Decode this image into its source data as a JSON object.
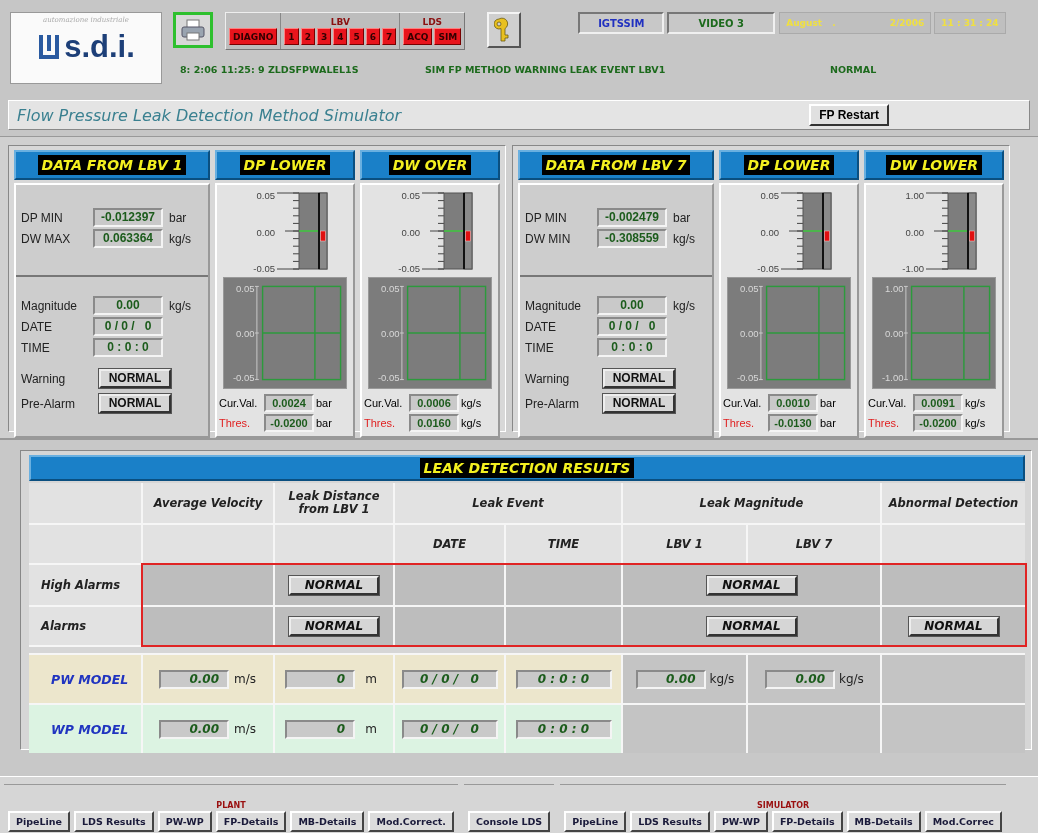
{
  "header": {
    "logo": {
      "tagline": "automazione industriale",
      "name": "s.d.i."
    },
    "diag_button": "DIAGNO",
    "lbv": {
      "label": "LBV",
      "buttons": [
        "1",
        "2",
        "3",
        "4",
        "5",
        "6",
        "7"
      ]
    },
    "lds": {
      "label": "LDS",
      "buttons": [
        "ACQ",
        "SIM"
      ]
    },
    "station": "IGTSSIM",
    "video": "VIDEO 3",
    "month": "August",
    "date_sep": ".",
    "date": "2/2006",
    "time": "11 : 31 : 24",
    "messages": [
      "8: 2:06 11:25: 9 ZLDSFPWALEL1S",
      "SIM FP METHOD WARNING LEAK EVENT LBV1",
      "NORMAL"
    ]
  },
  "title_bar": {
    "title": "Flow Pressure Leak Detection Method Simulator",
    "restart_button": "FP Restart"
  },
  "groups": [
    {
      "data_panel": {
        "title": "DATA FROM LBV 1",
        "readings": [
          {
            "label": "DP MIN",
            "value": "-0.012397",
            "unit": "bar"
          },
          {
            "label": "DW MAX",
            "value": "0.063364",
            "unit": "kg/s"
          }
        ],
        "event": [
          {
            "label": "Magnitude",
            "value": "0.00",
            "unit": "kg/s"
          },
          {
            "label": "DATE",
            "value": "0 / 0 /   0"
          },
          {
            "label": "TIME",
            "value": "0 : 0 : 0"
          }
        ],
        "status": [
          {
            "label": "Warning",
            "value": "NORMAL"
          },
          {
            "label": "Pre-Alarm",
            "value": "NORMAL"
          }
        ]
      },
      "gauges": [
        {
          "title": "DP LOWER",
          "scale": [
            "0.05",
            "0.00",
            "-0.05"
          ],
          "trend_scale": [
            "0.05",
            "0.00",
            "-0.05"
          ],
          "current": {
            "label": "Cur.Val.",
            "value": "0.0024",
            "unit": "bar"
          },
          "threshold": {
            "label": "Thres.",
            "value": "-0.0200",
            "unit": "bar"
          }
        },
        {
          "title": "DW OVER",
          "scale": [
            "0.05",
            "0.00",
            "-0.05"
          ],
          "trend_scale": [
            "0.05",
            "0.00",
            "-0.05"
          ],
          "current": {
            "label": "Cur.Val.",
            "value": "0.0006",
            "unit": "kg/s"
          },
          "threshold": {
            "label": "Thres.",
            "value": "0.0160",
            "unit": "kg/s"
          }
        }
      ]
    },
    {
      "data_panel": {
        "title": "DATA FROM LBV 7",
        "readings": [
          {
            "label": "DP MIN",
            "value": "-0.002479",
            "unit": "bar"
          },
          {
            "label": "DW MIN",
            "value": "-0.308559",
            "unit": "kg/s"
          }
        ],
        "event": [
          {
            "label": "Magnitude",
            "value": "0.00",
            "unit": "kg/s"
          },
          {
            "label": "DATE",
            "value": "0 / 0 /   0"
          },
          {
            "label": "TIME",
            "value": "0 : 0 : 0"
          }
        ],
        "status": [
          {
            "label": "Warning",
            "value": "NORMAL"
          },
          {
            "label": "Pre-Alarm",
            "value": "NORMAL"
          }
        ]
      },
      "gauges": [
        {
          "title": "DP LOWER",
          "scale": [
            "0.05",
            "0.00",
            "-0.05"
          ],
          "trend_scale": [
            "0.05",
            "0.00",
            "-0.05"
          ],
          "current": {
            "label": "Cur.Val.",
            "value": "0.0010",
            "unit": "bar"
          },
          "threshold": {
            "label": "Thres.",
            "value": "-0.0130",
            "unit": "bar"
          }
        },
        {
          "title": "DW LOWER",
          "scale": [
            "1.00",
            "0.00",
            "-1.00"
          ],
          "trend_scale": [
            "1.00",
            "0.00",
            "-1.00"
          ],
          "current": {
            "label": "Cur.Val.",
            "value": "0.0091",
            "unit": "kg/s"
          },
          "threshold": {
            "label": "Thres.",
            "value": "-0.0200",
            "unit": "kg/s"
          }
        }
      ]
    }
  ],
  "results": {
    "title": "LEAK DETECTION RESULTS",
    "columns": [
      "Average Velocity",
      "Leak Distance from LBV 1",
      "Leak Event",
      "Leak Magnitude",
      "Abnormal Detection"
    ],
    "subcolumns": [
      "DATE",
      "TIME",
      "LBV 1",
      "LBV 7"
    ],
    "alarm_rows": [
      {
        "label": "High Alarms",
        "leak_distance": "NORMAL",
        "leak_magnitude": "NORMAL"
      },
      {
        "label": "Alarms",
        "leak_distance": "NORMAL",
        "leak_magnitude": "NORMAL",
        "abnormal_detection": "NORMAL"
      }
    ],
    "model_rows": [
      {
        "label": "PW MODEL",
        "color": "#ece6cc",
        "velocity": {
          "value": "0.00",
          "unit": "m/s"
        },
        "distance": {
          "value": "0",
          "unit": "m"
        },
        "date": "0 / 0 /   0",
        "time": "0 : 0 : 0",
        "magnitude_lbv1": {
          "value": "0.00",
          "unit": "kg/s"
        },
        "magnitude_lbv7": {
          "value": "0.00",
          "unit": "kg/s"
        }
      },
      {
        "label": "WP MODEL",
        "color": "#dcf3e2",
        "velocity": {
          "value": "0.00",
          "unit": "m/s"
        },
        "distance": {
          "value": "0",
          "unit": "m"
        },
        "date": "0 / 0 /   0",
        "time": "0 : 0 : 0"
      }
    ]
  },
  "tab_groups": [
    {
      "label": "PLANT",
      "tabs": [
        "PipeLine",
        "LDS Results",
        "PW-WP",
        "FP-Details",
        "MB-Details",
        "Mod.Correct."
      ]
    },
    {
      "tabs": [
        "Console LDS"
      ]
    },
    {
      "label": "SIMULATOR",
      "tabs": [
        "PipeLine",
        "LDS Results",
        "PW-WP",
        "FP-Details",
        "MB-Details",
        "Mod.Correc"
      ]
    }
  ]
}
